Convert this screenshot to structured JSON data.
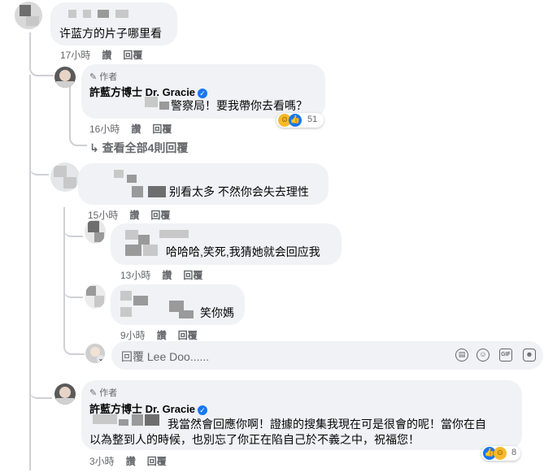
{
  "comments": {
    "c1": {
      "text": "许蓝方的片子哪里看",
      "time": "17小時",
      "like": "讚",
      "reply": "回覆"
    },
    "c2": {
      "badge": "作者",
      "author": "許藍方博士 Dr. Gracie",
      "text": "警察局！要我帶你去看嗎？",
      "reaction_count": "51",
      "time": "16小時",
      "like": "讚",
      "reply": "回覆"
    },
    "view_all": "查看全部4則回覆",
    "c3": {
      "text": "别看太多 不然你会失去理性",
      "time": "15小時",
      "like": "讚",
      "reply": "回覆"
    },
    "c4": {
      "text": "哈哈哈,笑死,我猜她就会回应我",
      "time": "13小時",
      "like": "讚",
      "reply": "回覆"
    },
    "c5": {
      "text": "笑你媽",
      "time": "9小時",
      "like": "讚",
      "reply": "回覆"
    },
    "reply_input": {
      "placeholder": "回覆 Lee Doo......"
    },
    "c6": {
      "badge": "作者",
      "author": "許藍方博士 Dr. Gracie",
      "line1": "我當然會回應你啊！證據的搜集我現在可是很會的呢！當你在自",
      "line2": "以為整到人的時候，也別忘了你正在陷自己於不義之中，祝福您！",
      "reaction_count": "8",
      "time": "3小時",
      "like": "讚",
      "reply": "回覆"
    }
  },
  "icons": {
    "pencil": "pencil-icon",
    "verified": "verified-badge-icon",
    "reply_arrow": "reply-arrow-icon",
    "sticker": "sticker-icon",
    "emoji": "emoji-icon",
    "gif": "gif-icon",
    "avatar_sticker": "avatar-sticker-icon"
  },
  "colors": {
    "accent": "#1877f2",
    "bubble": "#f0f2f5",
    "meta": "#65676b",
    "haha": "#f7b928"
  }
}
